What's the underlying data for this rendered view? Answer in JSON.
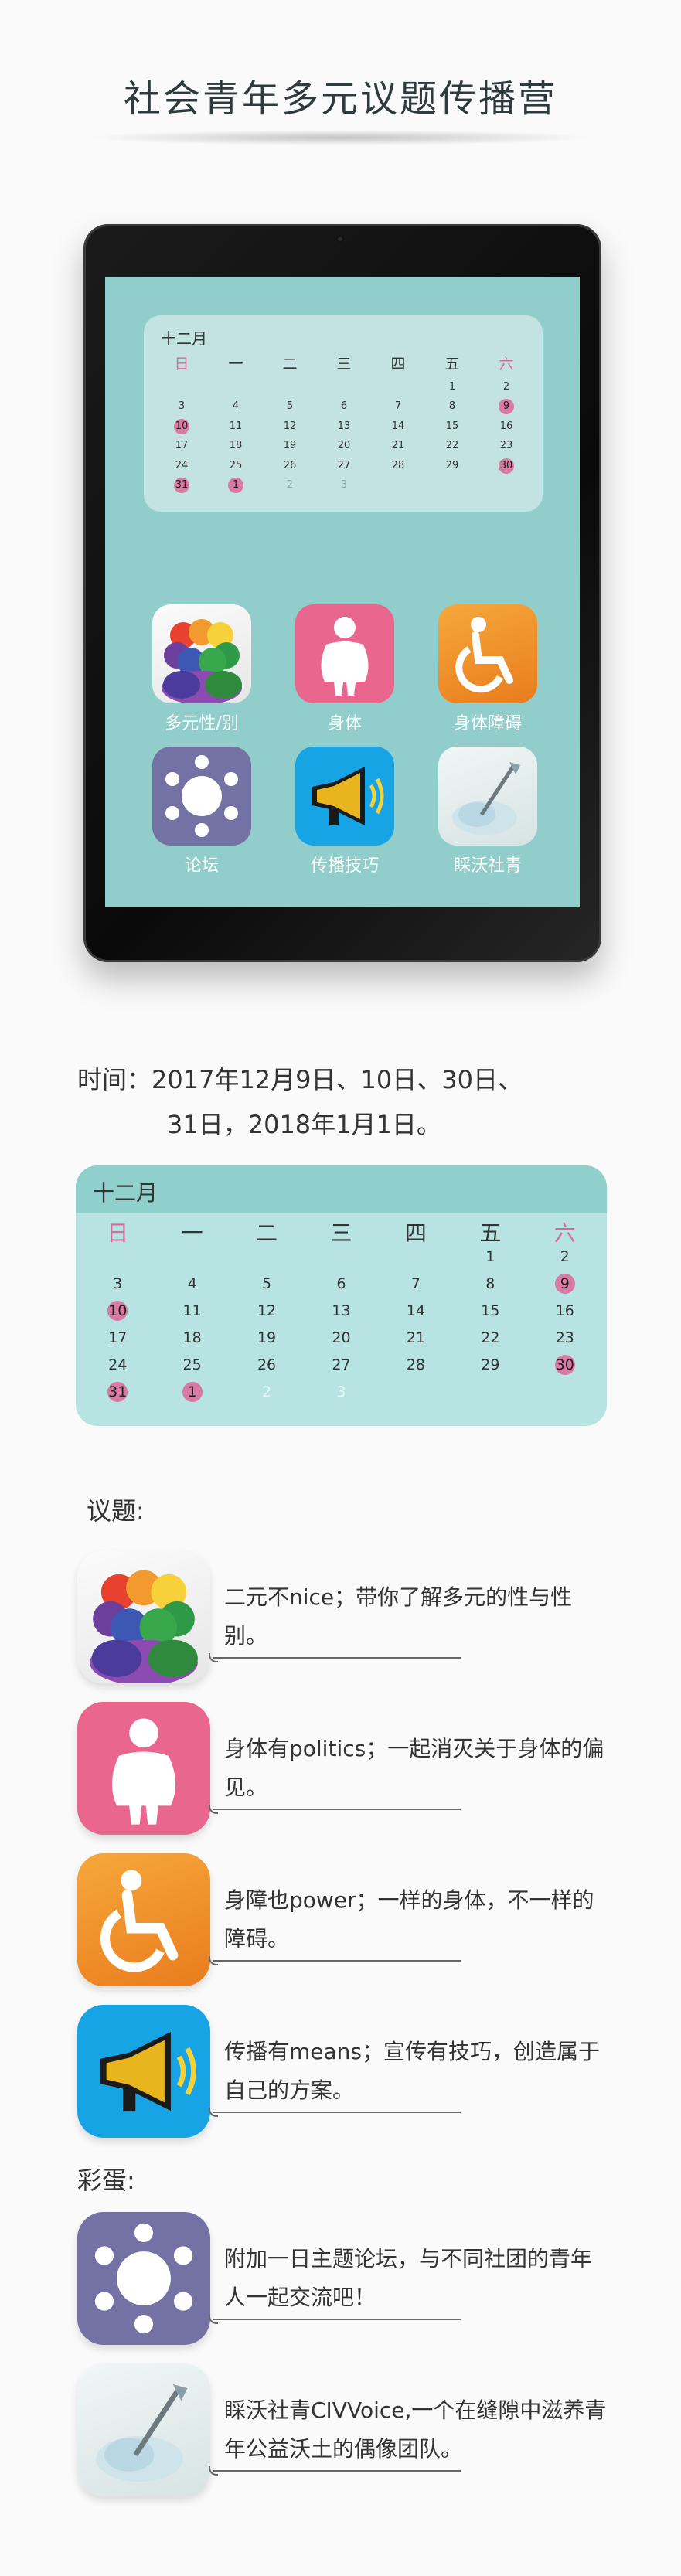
{
  "title": "社会青年多元议题传播营",
  "tablet": {
    "calendar": {
      "month": "十二月",
      "weekdays": [
        "日",
        "一",
        "二",
        "三",
        "四",
        "五",
        "六"
      ],
      "rows": [
        [
          "",
          "",
          "",
          "",
          "",
          "1",
          "2"
        ],
        [
          "3",
          "4",
          "5",
          "6",
          "7",
          "8",
          "9"
        ],
        [
          "10",
          "11",
          "12",
          "13",
          "14",
          "15",
          "16"
        ],
        [
          "17",
          "18",
          "19",
          "20",
          "21",
          "22",
          "23"
        ],
        [
          "24",
          "25",
          "26",
          "27",
          "28",
          "29",
          "30"
        ],
        [
          "31",
          "1",
          "2",
          "3",
          "",
          "",
          ""
        ]
      ],
      "highlighted": [
        "9",
        "10",
        "30",
        "31",
        "1"
      ]
    },
    "apps": [
      {
        "label": "多元性/别",
        "icon": "diversity-people-icon"
      },
      {
        "label": "身体",
        "icon": "body-figure-icon"
      },
      {
        "label": "身体障碍",
        "icon": "wheelchair-icon"
      },
      {
        "label": "论坛",
        "icon": "forum-circle-icon"
      },
      {
        "label": "传播技巧",
        "icon": "megaphone-icon"
      },
      {
        "label": "睬沃社青",
        "icon": "civvoice-logo-icon"
      }
    ]
  },
  "date_text": {
    "line1": "时间：2017年12月9日、10日、30日、",
    "line2": "31日，2018年1月1日。"
  },
  "calendar": {
    "month": "十二月",
    "weekdays": [
      "日",
      "一",
      "二",
      "三",
      "四",
      "五",
      "六"
    ],
    "rows": [
      [
        "",
        "",
        "",
        "",
        "",
        "1",
        "2"
      ],
      [
        "3",
        "4",
        "5",
        "6",
        "7",
        "8",
        "9"
      ],
      [
        "10",
        "11",
        "12",
        "13",
        "14",
        "15",
        "16"
      ],
      [
        "17",
        "18",
        "19",
        "20",
        "21",
        "22",
        "23"
      ],
      [
        "24",
        "25",
        "26",
        "27",
        "28",
        "29",
        "30"
      ],
      [
        "31",
        "1",
        "2",
        "3",
        "",
        "",
        ""
      ]
    ]
  },
  "topics_label": "议题:",
  "topics": [
    {
      "text": "二元不nice；带你了解多元的性与性别。",
      "icon": "diversity-people-icon"
    },
    {
      "text": "身体有politics；一起消灭关于身体的偏见。",
      "icon": "body-figure-icon"
    },
    {
      "text": "身障也power；一样的身体，不一样的障碍。",
      "icon": "wheelchair-icon"
    },
    {
      "text": "传播有means；宣传有技巧，创造属于自己的方案。",
      "icon": "megaphone-icon"
    }
  ],
  "bonus_label": "彩蛋:",
  "bonus": [
    {
      "text": "附加一日主题论坛，与不同社团的青年人一起交流吧！",
      "icon": "forum-circle-icon"
    },
    {
      "text": "睬沃社青CIVVoice,一个在缝隙中滋养青年公益沃土的偶像团队。",
      "icon": "civvoice-logo-icon"
    }
  ],
  "colors": {
    "screen_bg": "#91cdcb",
    "highlight": "#d87aa3",
    "calendar_bg": "#b7e3e3",
    "calendar_bar": "#8fd0cd"
  }
}
